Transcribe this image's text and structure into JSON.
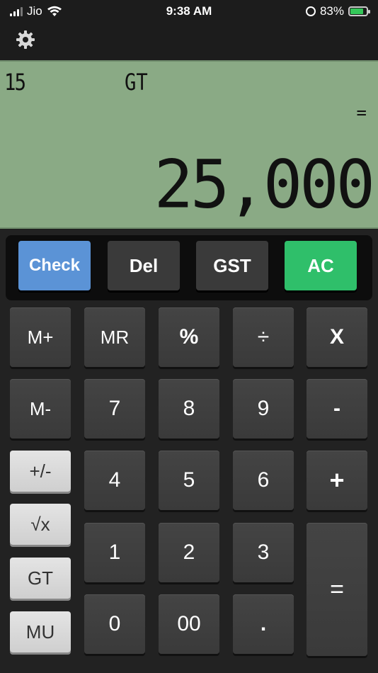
{
  "status_bar": {
    "carrier": "Jio",
    "time": "9:38 AM",
    "battery": "83%",
    "battery_fraction": 0.83,
    "icons": [
      "signal-icon",
      "wifi-icon",
      "rotation-lock-icon",
      "battery-charging-icon"
    ]
  },
  "toolbar": {
    "settings_icon": "gear-icon"
  },
  "display": {
    "count": "15",
    "gt": "GT",
    "operator": "=",
    "value": "25,000",
    "background": "#8aaa85"
  },
  "function_row": {
    "check": "Check",
    "del": "Del",
    "gst": "GST",
    "ac": "AC",
    "check_color": "#5b93d6",
    "ac_color": "#2fbf6a"
  },
  "keys": {
    "mplus": "M+",
    "mr": "MR",
    "percent": "%",
    "divide": "÷",
    "multiply": "X",
    "mminus": "M-",
    "seven": "7",
    "eight": "8",
    "nine": "9",
    "minus": "-",
    "plusminus": "+/-",
    "four": "4",
    "five": "5",
    "six": "6",
    "plus": "+",
    "sqrt": "√x",
    "one": "1",
    "two": "2",
    "three": "3",
    "equals": "=",
    "gt": "GT",
    "zero": "0",
    "doublezero": "00",
    "dot": ".",
    "mu": "MU"
  }
}
